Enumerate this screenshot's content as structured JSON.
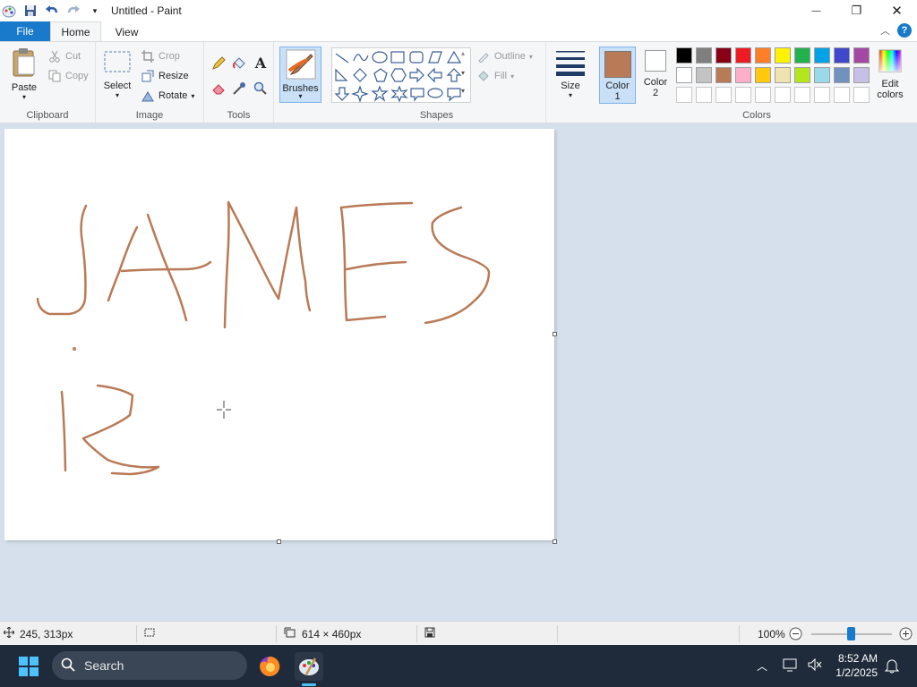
{
  "window": {
    "title": "Untitled - Paint",
    "minimize_glyph": "—",
    "maximize_glyph": "❐",
    "close_glyph": "✕"
  },
  "tabs": {
    "file": "File",
    "home": "Home",
    "view": "View"
  },
  "ribbon": {
    "clipboard": {
      "label": "Clipboard",
      "paste": "Paste",
      "cut": "Cut",
      "copy": "Copy"
    },
    "image": {
      "label": "Image",
      "select": "Select",
      "crop": "Crop",
      "resize": "Resize",
      "rotate": "Rotate"
    },
    "tools": {
      "label": "Tools"
    },
    "brushes": {
      "label": "Brushes"
    },
    "shapes": {
      "label": "Shapes",
      "outline": "Outline",
      "fill": "Fill"
    },
    "size": {
      "label": "Size"
    },
    "colors": {
      "label": "Colors",
      "color1_line1": "Color",
      "color1_line2": "1",
      "color2_line1": "Color",
      "color2_line2": "2",
      "color1": "#b97a57",
      "color2": "#ffffff",
      "edit_line1": "Edit",
      "edit_line2": "colors",
      "palette_row1": [
        "#000000",
        "#7f7f7f",
        "#880015",
        "#ed1c24",
        "#ff7f27",
        "#fff200",
        "#22b14c",
        "#00a2e8",
        "#3f48cc",
        "#a349a4"
      ],
      "palette_row2": [
        "#ffffff",
        "#c3c3c3",
        "#b97a57",
        "#ffaec9",
        "#ffc90e",
        "#efe4b0",
        "#b5e61d",
        "#99d9ea",
        "#7092be",
        "#c8bfe7"
      ]
    }
  },
  "canvas": {
    "stroke_color": "#b97a57"
  },
  "status": {
    "cursor_pos": "245, 313px",
    "canvas_size": "614 × 460px",
    "zoom": "100%"
  },
  "taskbar": {
    "search_placeholder": "Search",
    "time": "8:52 AM",
    "date": "1/2/2025"
  }
}
